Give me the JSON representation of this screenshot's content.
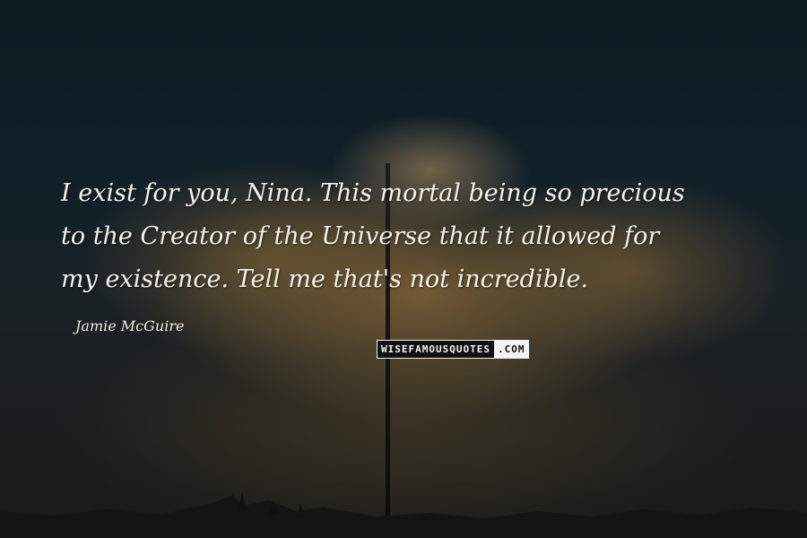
{
  "quote": {
    "lines": [
      "I exist for you, Nina. This mortal being so precious",
      "to the Creator of the Universe that it allowed for",
      "my existence. Tell me that's not incredible."
    ]
  },
  "author": "Jamie McGuire",
  "watermark": {
    "main": "WISEFAMOUSQUOTES",
    "tld": ".COM"
  },
  "colors": {
    "sky": "#0e1a22",
    "cloud": "#78603a",
    "text": "#f4f1ea"
  }
}
